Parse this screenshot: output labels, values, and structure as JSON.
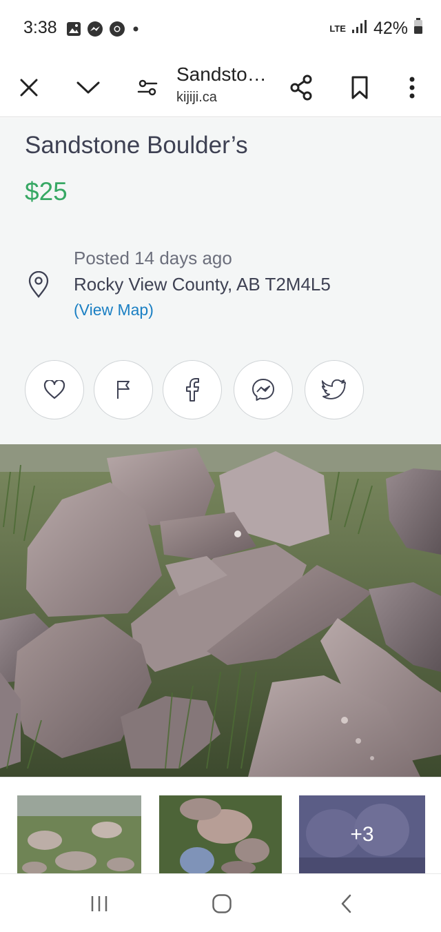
{
  "status_bar": {
    "time": "3:38",
    "network": "LTE",
    "battery": "42%"
  },
  "toolbar": {
    "title": "Sandstone Boulder’s",
    "domain": "kijiji.ca"
  },
  "listing": {
    "title": "Sandstone Boulder’s",
    "price": "$25",
    "posted": "Posted 14 days ago",
    "address": "Rocky View County, AB T2M4L5",
    "view_map": "(View Map)"
  },
  "share_buttons": [
    "heart-icon",
    "flag-icon",
    "facebook-icon",
    "messenger-icon",
    "twitter-icon"
  ],
  "gallery": {
    "more_count": "+3"
  },
  "colors": {
    "price": "#37a864",
    "link": "#1a7fc3",
    "title": "#3e4153",
    "muted": "#6c6f7c",
    "panel": "#f4f6f6"
  }
}
